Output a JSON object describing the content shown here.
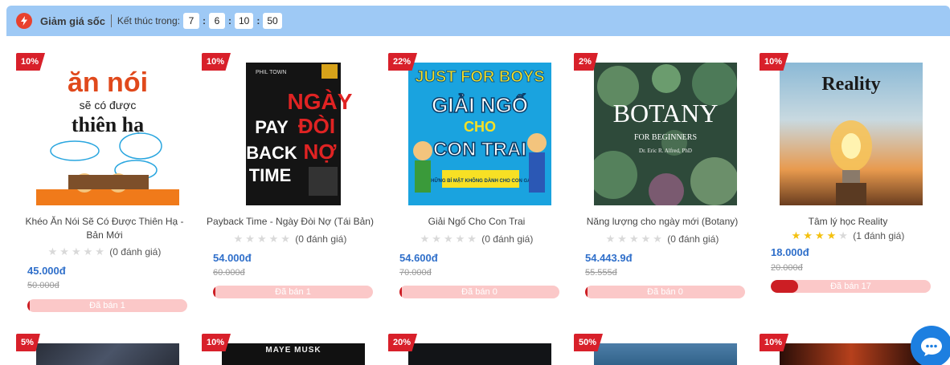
{
  "flash_sale": {
    "title": "Giảm giá sốc",
    "ends_in_label": "Kết thúc trong:",
    "countdown": [
      "7",
      "6",
      "10",
      "50"
    ],
    "icon": "lightning-icon"
  },
  "products": [
    {
      "discount": "10%",
      "title": "Khéo Ăn Nói Sẽ Có Được Thiên Hạ - Bản Mới",
      "rating_stars": 0,
      "rating_text": "(0 đánh giá)",
      "price": "45.000đ",
      "old_price": "50.000đ",
      "sold_label": "Đã bán 1",
      "sold_fraction": 0.01,
      "cover_text": [
        "ăn nói",
        "sẽ có được",
        "thiên hạ"
      ]
    },
    {
      "discount": "10%",
      "title": "Payback Time - Ngày Đòi Nợ (Tái Bản)",
      "rating_stars": 0,
      "rating_text": "(0 đánh giá)",
      "price": "54.000đ",
      "old_price": "60.000đ",
      "sold_label": "Đã bán 1",
      "sold_fraction": 0.01,
      "cover_text": [
        "PHIL TOWN",
        "NGÀY",
        "PAY",
        "ĐÒI",
        "BACK",
        "NỢ",
        "TIME"
      ]
    },
    {
      "discount": "22%",
      "title": "Giải Ngố Cho Con Trai",
      "rating_stars": 0,
      "rating_text": "(0 đánh giá)",
      "price": "54.600đ",
      "old_price": "70.000đ",
      "sold_label": "Đã bán 0",
      "sold_fraction": 0,
      "cover_text": [
        "JUST FOR BOYS",
        "GIẢI NGỐ",
        "CHO",
        "CON TRAI",
        "NHỮNG BÍ MẬT KHÔNG DÀNH CHO CON GÁI"
      ]
    },
    {
      "discount": "2%",
      "title": "Năng lượng cho ngày mới (Botany)",
      "rating_stars": 0,
      "rating_text": "(0 đánh giá)",
      "price": "54.443.9đ",
      "old_price": "55.555đ",
      "sold_label": "Đã bán 0",
      "sold_fraction": 0,
      "cover_text": [
        "BOTANY",
        "FOR BEGINNERS",
        "Dr. Eric R. Alfred, PhD"
      ]
    },
    {
      "discount": "10%",
      "title": "Tâm lý học Reality",
      "rating_stars": 4,
      "rating_text": "(1 đánh giá)",
      "price": "18.000đ",
      "old_price": "20.000đ",
      "sold_label": "Đã bán 17",
      "sold_fraction": 0.17,
      "cover_text": [
        "Reality"
      ]
    }
  ],
  "second_row": [
    {
      "discount": "5%",
      "cover_text": ""
    },
    {
      "discount": "10%",
      "cover_text": "MAYE MUSK"
    },
    {
      "discount": "20%",
      "cover_text": ""
    },
    {
      "discount": "50%",
      "cover_text": ""
    },
    {
      "discount": "10%",
      "cover_text": ""
    }
  ],
  "colors": {
    "header_bg": "#9ec9f5",
    "badge": "#d8202a",
    "price": "#2f6fca",
    "sold_bar_bg": "#fbc8c8",
    "sold_bar_fill": "#cc1e24"
  },
  "chat": {
    "icon": "chat-bubble-icon"
  }
}
